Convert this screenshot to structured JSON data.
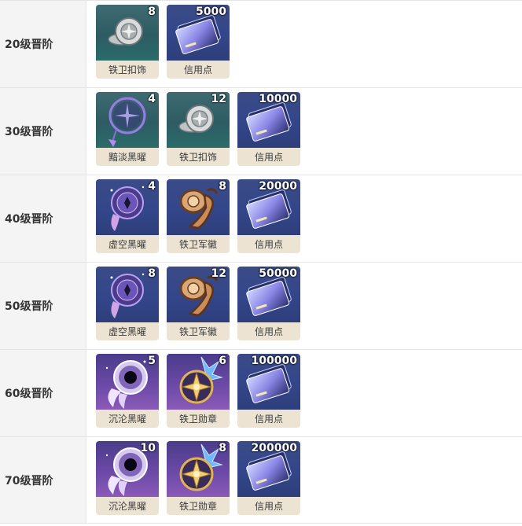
{
  "colors": {
    "teal": "#2d5c62",
    "blue": "#33468a",
    "purple": "#6b49a6",
    "card_label_bg": "#ece3d2",
    "row_label_bg": "#f4f4f4"
  },
  "rows": [
    {
      "level": "20级晋阶",
      "items": [
        {
          "name": "铁卫扣饰",
          "count": "8",
          "icon": "silver-badge-icon",
          "bg": "teal"
        },
        {
          "name": "信用点",
          "count": "5000",
          "icon": "credit-card-icon",
          "bg": "blue"
        }
      ]
    },
    {
      "level": "30级晋阶",
      "items": [
        {
          "name": "黯淡黑曜",
          "count": "4",
          "icon": "dreamcatcher-icon",
          "bg": "teal"
        },
        {
          "name": "铁卫扣饰",
          "count": "12",
          "icon": "silver-badge-icon",
          "bg": "teal"
        },
        {
          "name": "信用点",
          "count": "10000",
          "icon": "credit-card-icon",
          "bg": "blue"
        }
      ]
    },
    {
      "level": "40级晋阶",
      "items": [
        {
          "name": "虚空黑曜",
          "count": "4",
          "icon": "void-dreamcatcher-icon",
          "bg": "blue"
        },
        {
          "name": "铁卫军徽",
          "count": "8",
          "icon": "bronze-insignia-icon",
          "bg": "blue"
        },
        {
          "name": "信用点",
          "count": "20000",
          "icon": "credit-card-icon",
          "bg": "blue"
        }
      ]
    },
    {
      "level": "50级晋阶",
      "items": [
        {
          "name": "虚空黑曜",
          "count": "8",
          "icon": "void-dreamcatcher-icon",
          "bg": "blue"
        },
        {
          "name": "铁卫军徽",
          "count": "12",
          "icon": "bronze-insignia-icon",
          "bg": "blue"
        },
        {
          "name": "信用点",
          "count": "50000",
          "icon": "credit-card-icon",
          "bg": "blue"
        }
      ]
    },
    {
      "level": "60级晋阶",
      "items": [
        {
          "name": "沉沦黑曜",
          "count": "5",
          "icon": "abyss-dreamcatcher-icon",
          "bg": "purple"
        },
        {
          "name": "铁卫勋章",
          "count": "6",
          "icon": "gold-medal-icon",
          "bg": "purple"
        },
        {
          "name": "信用点",
          "count": "100000",
          "icon": "credit-card-icon",
          "bg": "blue"
        }
      ]
    },
    {
      "level": "70级晋阶",
      "items": [
        {
          "name": "沉沦黑曜",
          "count": "10",
          "icon": "abyss-dreamcatcher-icon",
          "bg": "purple"
        },
        {
          "name": "铁卫勋章",
          "count": "8",
          "icon": "gold-medal-icon",
          "bg": "purple"
        },
        {
          "name": "信用点",
          "count": "200000",
          "icon": "credit-card-icon",
          "bg": "blue"
        }
      ]
    }
  ]
}
